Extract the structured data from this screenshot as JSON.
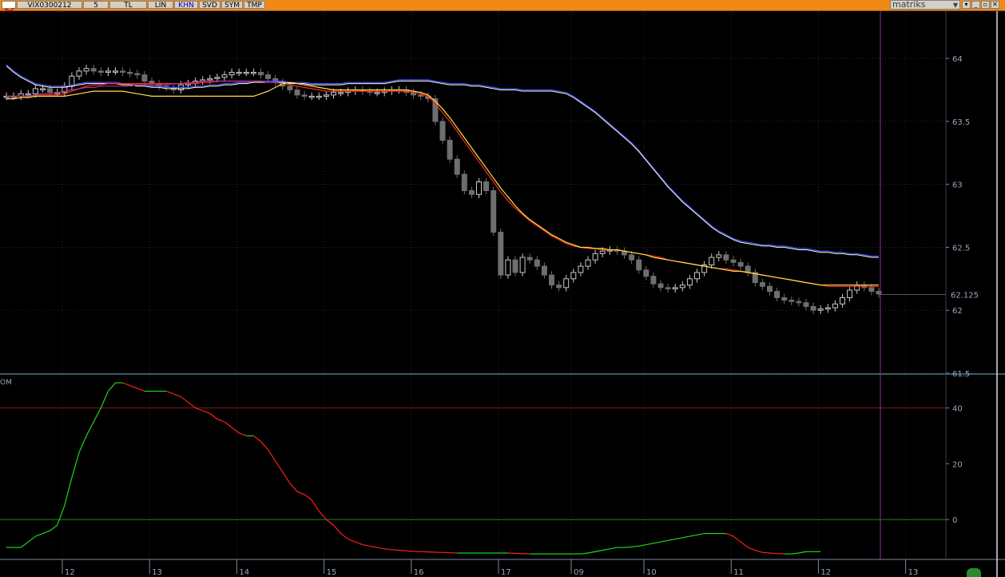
{
  "toolbar": {
    "symbol": "VIX0300212",
    "interval": "5",
    "items": [
      "TL",
      "LIN",
      "KHN",
      "SVD",
      "SYM",
      "TMP"
    ],
    "active_item": "KHN",
    "brand": "matriks"
  },
  "colors": {
    "toolbar_bg": "#f08a14",
    "background": "#000000",
    "grid": "#2a2a2a",
    "axis_text": "#9aa6c0",
    "candle_up": "#c8c8c8",
    "candle_down": "#6e6e6e",
    "ma_blue": "#3f4cff",
    "ma_white": "#ffffe6",
    "ma_red": "#ff2a1e",
    "ma_yellow": "#ffe24a",
    "ma_purple": "#b03090",
    "osc_up": "#1ed81e",
    "osc_down": "#ff1e1e",
    "crosshair": "#9a2a9a",
    "level_40": "#8a1a1a",
    "level_0": "#1f8a1f"
  },
  "chart_data": [
    {
      "type": "candlestick",
      "title": "",
      "y_ticks": [
        64,
        63.5,
        63,
        62.5,
        62,
        61.5
      ],
      "y_tick_labels": [
        "64",
        "63.5",
        "63",
        "62.5",
        "62",
        "61.5"
      ],
      "ylim": [
        61.5,
        64.35
      ],
      "last_price_label": "62.125",
      "last_price": 62.125,
      "x_tick_labels": [
        "12",
        "13",
        "14",
        "15",
        "16",
        "17",
        "09",
        "10",
        "11",
        "12",
        "13"
      ],
      "x_ticks_index": [
        0,
        12,
        24,
        36,
        48,
        60,
        70,
        80,
        92,
        104,
        116
      ],
      "bars_count": 121,
      "grid": true,
      "closes": [
        63.7,
        63.7,
        63.72,
        63.72,
        63.76,
        63.76,
        63.73,
        63.73,
        63.78,
        63.86,
        63.9,
        63.92,
        63.9,
        63.89,
        63.9,
        63.9,
        63.89,
        63.88,
        63.87,
        63.82,
        63.8,
        63.78,
        63.77,
        63.75,
        63.79,
        63.8,
        63.82,
        63.83,
        63.84,
        63.85,
        63.87,
        63.89,
        63.89,
        63.89,
        63.89,
        63.87,
        63.84,
        63.81,
        63.78,
        63.75,
        63.71,
        63.7,
        63.7,
        63.7,
        63.71,
        63.73,
        63.73,
        63.74,
        63.75,
        63.74,
        63.73,
        63.73,
        63.74,
        63.75,
        63.75,
        63.73,
        63.71,
        63.7,
        63.68,
        63.5,
        63.35,
        63.2,
        63.08,
        62.95,
        62.92,
        63.02,
        62.95,
        62.62,
        62.28,
        62.4,
        62.3,
        62.42,
        62.4,
        62.35,
        62.28,
        62.2,
        62.18,
        62.25,
        62.3,
        62.35,
        62.4,
        62.45,
        62.47,
        62.48,
        62.47,
        62.44,
        62.4,
        62.32,
        62.27,
        62.21,
        62.18,
        62.17,
        62.18,
        62.2,
        62.25,
        62.3,
        62.36,
        62.42,
        62.44,
        62.4,
        62.38,
        62.35,
        62.3,
        62.22,
        62.19,
        62.15,
        62.1,
        62.08,
        62.07,
        62.06,
        62.03,
        62.0,
        62.01,
        62.02,
        62.05,
        62.1,
        62.16,
        62.2,
        62.18,
        62.15,
        62.13
      ],
      "moving_averages": [
        {
          "color": "blue",
          "values": [
            63.95,
            63.9,
            63.86,
            63.83,
            63.8,
            63.79,
            63.78,
            63.78,
            63.78,
            63.79,
            63.8,
            63.81,
            63.81,
            63.81,
            63.81,
            63.81,
            63.8,
            63.8,
            63.79,
            63.79,
            63.78,
            63.78,
            63.77,
            63.77,
            63.77,
            63.77,
            63.78,
            63.78,
            63.79,
            63.79,
            63.8,
            63.8,
            63.81,
            63.81,
            63.82,
            63.82,
            63.82,
            63.82,
            63.82,
            63.81,
            63.81,
            63.81,
            63.8,
            63.8,
            63.8,
            63.8,
            63.8,
            63.81,
            63.81,
            63.81,
            63.81,
            63.81,
            63.81,
            63.82,
            63.83,
            63.83,
            63.83,
            63.83,
            63.83,
            63.82,
            63.81,
            63.8,
            63.8,
            63.8,
            63.79,
            63.79,
            63.78,
            63.77,
            63.76,
            63.76,
            63.76,
            63.75,
            63.75,
            63.75,
            63.75,
            63.75,
            63.74,
            63.73,
            63.7,
            63.66,
            63.62,
            63.58,
            63.53,
            63.48,
            63.43,
            63.38,
            63.33,
            63.27,
            63.2,
            63.13,
            63.06,
            62.99,
            62.93,
            62.87,
            62.82,
            62.77,
            62.72,
            62.67,
            62.63,
            62.6,
            62.57,
            62.55,
            62.54,
            62.53,
            62.52,
            62.52,
            62.51,
            62.51,
            62.5,
            62.49,
            62.49,
            62.48,
            62.47,
            62.47,
            62.46,
            62.46,
            62.45,
            62.45,
            62.44,
            62.43,
            62.43
          ]
        },
        {
          "color": "red",
          "values": [
            63.7,
            63.7,
            63.7,
            63.7,
            63.71,
            63.71,
            63.71,
            63.71,
            63.72,
            63.74,
            63.76,
            63.78,
            63.79,
            63.79,
            63.8,
            63.8,
            63.8,
            63.8,
            63.8,
            63.8,
            63.8,
            63.8,
            63.8,
            63.8,
            63.8,
            63.8,
            63.8,
            63.81,
            63.81,
            63.82,
            63.82,
            63.82,
            63.82,
            63.82,
            63.82,
            63.82,
            63.81,
            63.81,
            63.8,
            63.79,
            63.78,
            63.77,
            63.76,
            63.75,
            63.74,
            63.74,
            63.74,
            63.74,
            63.74,
            63.74,
            63.74,
            63.74,
            63.74,
            63.74,
            63.74,
            63.74,
            63.73,
            63.72,
            63.7,
            63.64,
            63.57,
            63.5,
            63.42,
            63.34,
            63.26,
            63.18,
            63.1,
            63.02,
            62.94,
            62.87,
            62.81,
            62.76,
            62.71,
            62.67,
            62.63,
            62.59,
            62.56,
            62.53,
            62.51,
            62.5,
            62.49,
            62.49,
            62.48,
            62.48,
            62.48,
            62.47,
            62.46,
            62.45,
            62.44,
            62.43,
            62.42,
            62.4,
            62.39,
            62.38,
            62.37,
            62.36,
            62.35,
            62.34,
            62.33,
            62.33,
            62.32,
            62.31,
            62.3,
            62.29,
            62.28,
            62.27,
            62.26,
            62.25,
            62.24,
            62.23,
            62.22,
            62.21,
            62.2,
            62.19,
            62.19,
            62.19,
            62.19,
            62.19,
            62.19,
            62.19,
            62.19
          ]
        },
        {
          "color": "yellow",
          "values": [
            63.68,
            63.68,
            63.69,
            63.69,
            63.7,
            63.7,
            63.7,
            63.7,
            63.7,
            63.71,
            63.72,
            63.73,
            63.74,
            63.74,
            63.74,
            63.74,
            63.74,
            63.73,
            63.72,
            63.71,
            63.7,
            63.7,
            63.7,
            63.7,
            63.7,
            63.7,
            63.7,
            63.7,
            63.7,
            63.7,
            63.7,
            63.7,
            63.7,
            63.7,
            63.7,
            63.72,
            63.74,
            63.77,
            63.8,
            63.81,
            63.8,
            63.79,
            63.78,
            63.77,
            63.76,
            63.75,
            63.75,
            63.75,
            63.75,
            63.75,
            63.75,
            63.75,
            63.75,
            63.75,
            63.75,
            63.75,
            63.74,
            63.73,
            63.71,
            63.66,
            63.6,
            63.53,
            63.45,
            63.37,
            63.29,
            63.21,
            63.13,
            63.05,
            62.97,
            62.9,
            62.83,
            62.77,
            62.72,
            62.68,
            62.64,
            62.6,
            62.57,
            62.54,
            62.52,
            62.5,
            62.5,
            62.49,
            62.49,
            62.48,
            62.48,
            62.47,
            62.46,
            62.45,
            62.44,
            62.42,
            62.41,
            62.4,
            62.39,
            62.38,
            62.37,
            62.36,
            62.35,
            62.34,
            62.33,
            62.32,
            62.31,
            62.31,
            62.3,
            62.29,
            62.28,
            62.27,
            62.26,
            62.25,
            62.24,
            62.23,
            62.22,
            62.21,
            62.2,
            62.2,
            62.2,
            62.2,
            62.2,
            62.2,
            62.2,
            62.2,
            62.2
          ]
        },
        {
          "color": "purple",
          "values": [
            63.7,
            63.7,
            63.7,
            63.7,
            63.71,
            63.72,
            63.72,
            63.73,
            63.74,
            63.75,
            63.76,
            63.77,
            63.77,
            63.78,
            63.78,
            63.78,
            63.78,
            63.78,
            63.79,
            63.79,
            63.79,
            63.79,
            63.79,
            63.8,
            63.8,
            63.81,
            63.81,
            63.82,
            63.82,
            63.82,
            63.82,
            63.82,
            63.82,
            63.82,
            63.82,
            63.82,
            63.81,
            63.81,
            63.8
          ]
        }
      ]
    },
    {
      "type": "line",
      "title": "",
      "label": "OM",
      "y_ticks": [
        40,
        20,
        0
      ],
      "y_tick_labels": [
        "40",
        "20",
        "0"
      ],
      "ylim": [
        -14,
        51
      ],
      "reference_lines": [
        40,
        0
      ],
      "values": [
        -10,
        -10,
        -10,
        -8,
        -6,
        -5,
        -4,
        -2,
        5,
        15,
        24,
        30,
        35,
        40,
        46,
        49,
        49,
        48,
        47,
        46,
        46,
        46,
        46,
        45,
        44,
        42,
        40,
        39,
        38,
        36,
        35,
        33,
        31,
        30,
        30,
        28,
        25,
        21,
        17,
        13,
        10,
        9,
        7,
        3,
        0,
        -2,
        -5,
        -7,
        -8,
        -9,
        -9.5,
        -10,
        -10.5,
        -10.8,
        -11,
        -11.2,
        -11.4,
        -11.5,
        -11.6,
        -11.7,
        -11.8,
        -11.9,
        -12,
        -12,
        -12,
        -12,
        -12,
        -12,
        -12,
        -12,
        -12.1,
        -12.2,
        -12.3,
        -12.3,
        -12.3,
        -12.3,
        -12.3,
        -12.3,
        -12.3,
        -12.3,
        -12,
        -11.5,
        -11,
        -10.5,
        -10,
        -10,
        -9.8,
        -9.5,
        -9,
        -8.5,
        -8,
        -7.5,
        -7,
        -6.5,
        -6,
        -5.5,
        -5,
        -5,
        -5,
        -5,
        -6,
        -8,
        -10,
        -11,
        -11.8,
        -12,
        -12.2,
        -12.3,
        -12.3,
        -12,
        -11.5,
        -11.5,
        -11.5
      ]
    }
  ]
}
